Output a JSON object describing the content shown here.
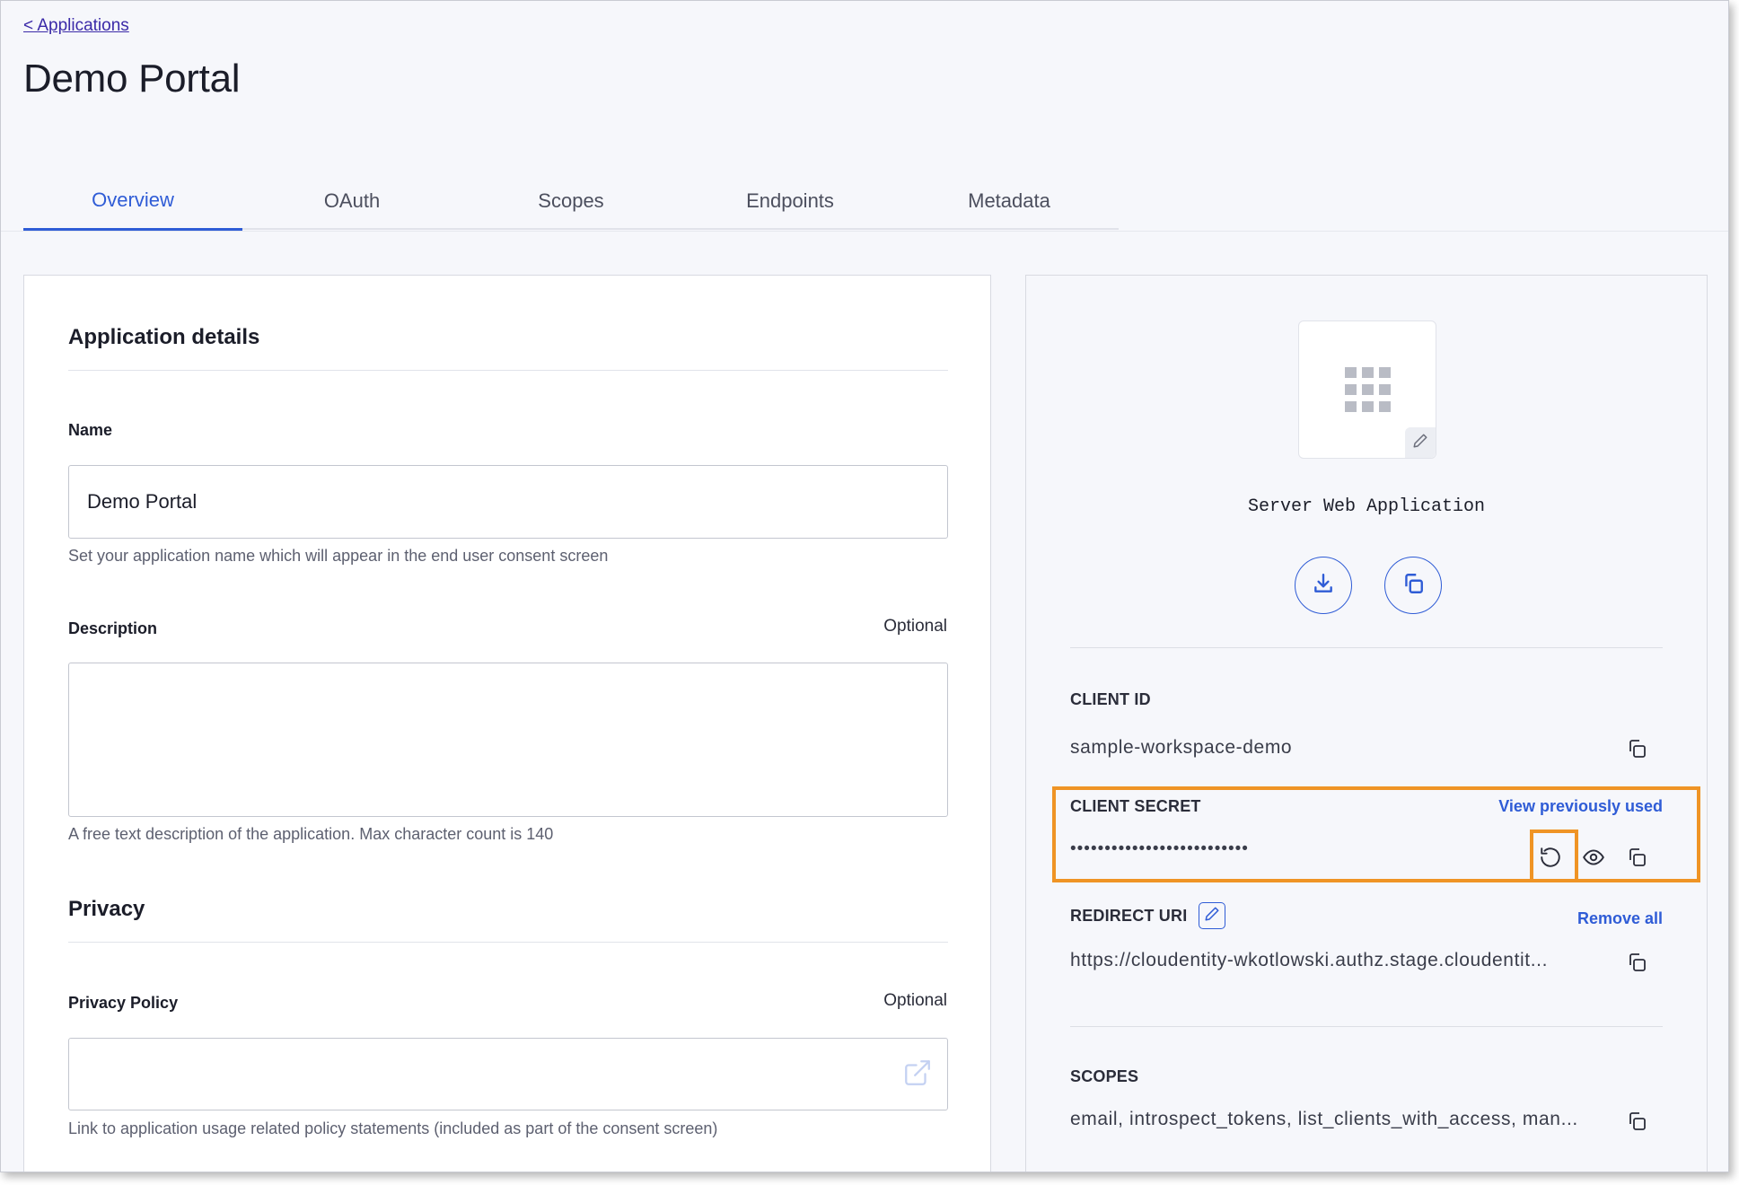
{
  "breadcrumb": {
    "back_label": "< Applications"
  },
  "page": {
    "title": "Demo Portal"
  },
  "tabs": [
    {
      "label": "Overview",
      "active": true
    },
    {
      "label": "OAuth",
      "active": false
    },
    {
      "label": "Scopes",
      "active": false
    },
    {
      "label": "Endpoints",
      "active": false
    },
    {
      "label": "Metadata",
      "active": false
    }
  ],
  "details": {
    "section_title": "Application details",
    "name": {
      "label": "Name",
      "value": "Demo Portal",
      "helper": "Set your application name which will appear in the end user consent screen"
    },
    "description": {
      "label": "Description",
      "optional_label": "Optional",
      "value": "",
      "helper": "A free text description of the application. Max character count is 140"
    }
  },
  "privacy": {
    "section_title": "Privacy",
    "policy": {
      "label": "Privacy Policy",
      "optional_label": "Optional",
      "value": "",
      "helper": "Link to application usage related policy statements (included as part of the consent screen)"
    }
  },
  "app_summary": {
    "type_label": "Server Web Application",
    "icons": [
      "grid-icon",
      "pencil-icon",
      "download-icon",
      "copy-icon"
    ],
    "client_id": {
      "label": "CLIENT ID",
      "value": "sample-workspace-demo"
    },
    "client_secret": {
      "label": "CLIENT SECRET",
      "value": "••••••••••••••••••••••••••",
      "link": "View previously used"
    },
    "redirect_uri": {
      "label": "REDIRECT URI",
      "value": "https://cloudentity-wkotlowski.authz.stage.cloudentit...",
      "link": "Remove all"
    },
    "scopes": {
      "label": "SCOPES",
      "value": "email, introspect_tokens, list_clients_with_access, man..."
    }
  },
  "colors": {
    "accent": "#2f5cd6",
    "highlight": "#ef9425",
    "background": "#f6f7fb"
  }
}
